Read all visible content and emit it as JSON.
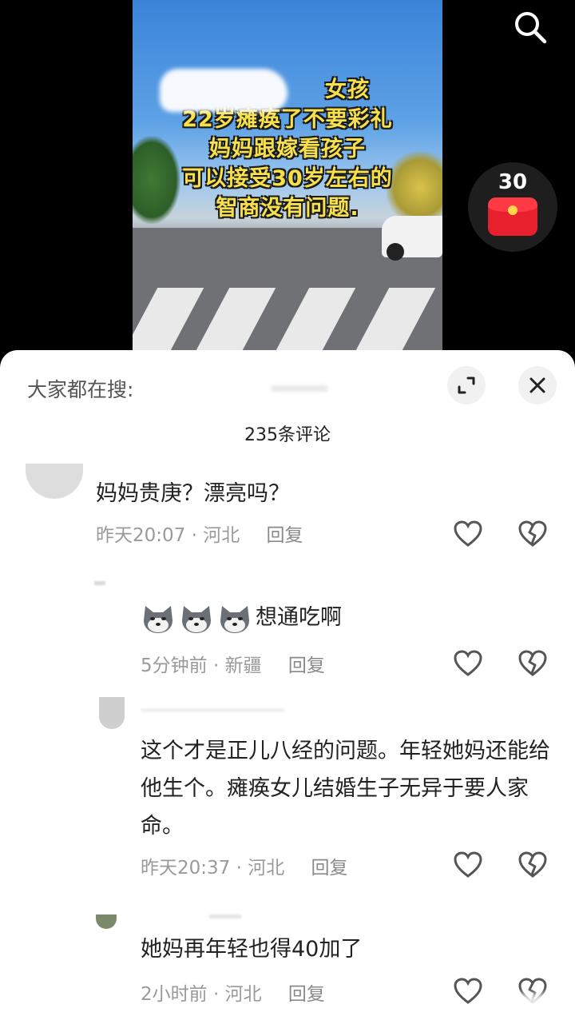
{
  "video": {
    "caption_lines": [
      "女孩",
      "22岁瘫痪了不要彩礼",
      "妈妈跟嫁看孩子",
      "可以接受30岁左右的",
      "智商没有问题."
    ]
  },
  "red_packet": {
    "count": "30"
  },
  "sheet": {
    "search_hint": "大家都在搜:",
    "comment_count": "235条评论"
  },
  "comments": [
    {
      "text": "妈妈贵庚？漂亮吗？",
      "time": "昨天20:07",
      "location": "河北",
      "reply": "回复"
    },
    {
      "text": "想通吃啊",
      "time": "5分钟前",
      "location": "新疆",
      "reply": "回复"
    },
    {
      "text": "这个才是正儿八经的问题。年轻她妈还能给他生个。瘫痪女儿结婚生子无异于要人家命。",
      "time": "昨天20:37",
      "location": "河北",
      "reply": "回复"
    },
    {
      "text": "她妈再年轻也得40加了",
      "time": "2小时前",
      "location": "河北",
      "reply": "回复"
    }
  ],
  "icons": {
    "search": "search-icon",
    "expand": "expand-icon",
    "close": "close-icon",
    "like": "heart-icon",
    "dislike": "broken-heart-icon",
    "emoji": "husky-dog-emoji"
  },
  "colors": {
    "caption_yellow": "#f7e04a",
    "red_packet": "#e8202e",
    "meta_gray": "#9a9a9a"
  }
}
